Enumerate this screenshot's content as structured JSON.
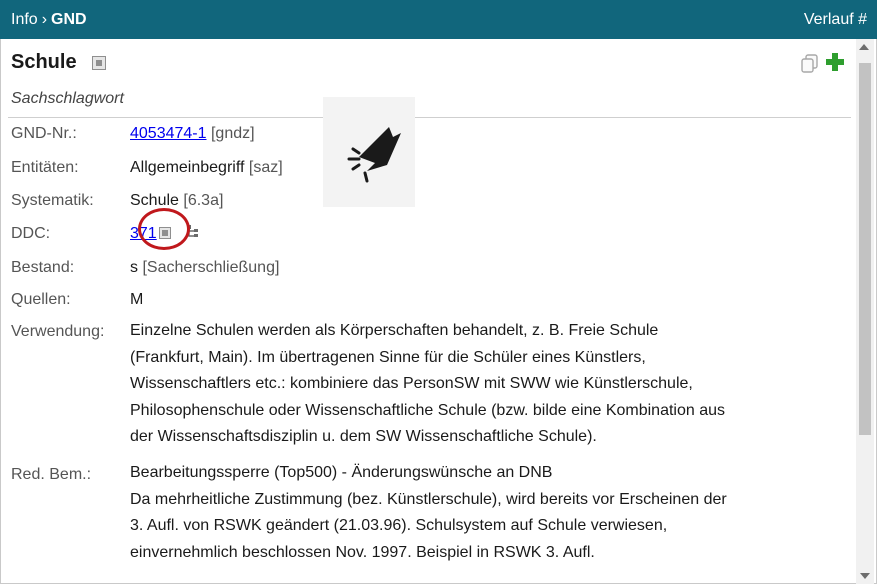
{
  "header": {
    "breadcrumb_root": "Info",
    "breadcrumb_sep": "›",
    "breadcrumb_current": "GND",
    "history_link": "Verlauf #"
  },
  "record": {
    "title": "Schule",
    "subtitle": "Sachschlagwort",
    "fields": {
      "gnd_nr": {
        "label": "GND-Nr.:",
        "link": "4053474-1",
        "suffix": "[gndz]"
      },
      "entitaeten": {
        "label": "Entitäten:",
        "value": "Allgemeinbegriff",
        "suffix": "[saz]"
      },
      "systematik": {
        "label": "Systematik:",
        "value": "Schule",
        "suffix": "[6.3a]"
      },
      "ddc": {
        "label": "DDC:",
        "link": "371"
      },
      "bestand": {
        "label": "Bestand:",
        "value": "s",
        "suffix": "[Sacherschließung]"
      },
      "quellen": {
        "label": "Quellen:",
        "value": "M"
      },
      "verwendung": {
        "label": "Verwendung:",
        "lines": [
          "Einzelne Schulen werden als Körperschaften behandelt, z. B. Freie Schule",
          "(Frankfurt, Main). Im übertragenen Sinne für die Schüler eines Künstlers,",
          "Wissenschaftlers etc.: kombiniere das PersonSW mit SWW wie Künstlerschule,",
          "Philosophenschule oder Wissenschaftliche Schule (bzw. bilde eine Kombination aus",
          "der Wissenschaftsdisziplin u. dem SW Wissenschaftliche Schule)."
        ]
      },
      "red_bem": {
        "label": "Red. Bem.:",
        "lines": [
          "Bearbeitungssperre (Top500) - Änderungswünsche an DNB",
          "Da mehrheitliche Zustimmung (bez. Künstlerschule), wird bereits vor Erscheinen der",
          "3. Aufl. von RSWK geändert (21.03.96). Schulsystem auf Schule verwiesen,",
          "einvernehmlich beschlossen Nov. 1997. Beispiel in RSWK 3. Aufl."
        ]
      }
    }
  },
  "colors": {
    "header_bg": "#11667c",
    "link": "#0000ee",
    "highlight_circle": "#c0181c",
    "plus_icon": "#2e9e2e"
  },
  "icons": [
    "copy-icon",
    "plus-icon",
    "expand-box-icon",
    "tree-icon",
    "click-cursor-icon"
  ]
}
